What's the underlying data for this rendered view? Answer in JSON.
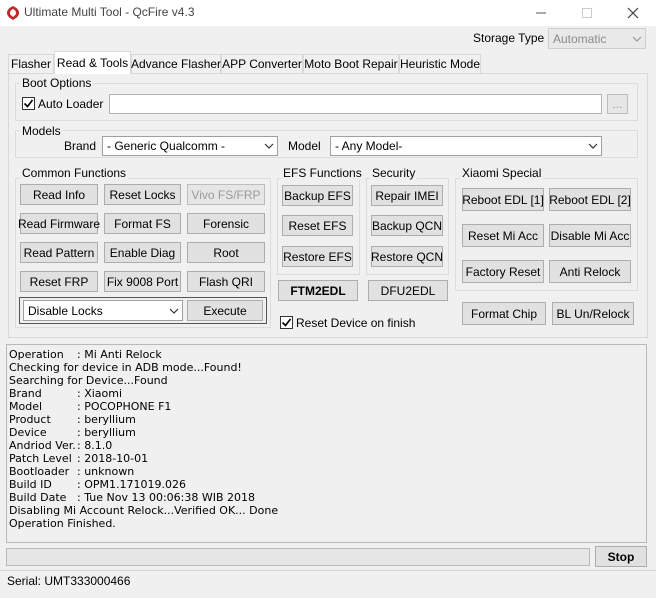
{
  "window": {
    "title": "Ultimate Multi Tool - QcFire v4.3",
    "icon": "snapdragon-icon"
  },
  "storage": {
    "label": "Storage Type",
    "value": "Automatic"
  },
  "tabs": [
    {
      "label": "Flasher"
    },
    {
      "label": "Read & Tools"
    },
    {
      "label": "Advance Flasher"
    },
    {
      "label": "APP Converter"
    },
    {
      "label": "Moto Boot Repair"
    },
    {
      "label": "Heuristic Mode"
    }
  ],
  "boot_options": {
    "title": "Boot Options",
    "auto_loader_label": "Auto Loader",
    "auto_loader_checked": true,
    "path_value": "",
    "browse_label": "..."
  },
  "models": {
    "title": "Models",
    "brand_label": "Brand",
    "brand_value": "- Generic Qualcomm -",
    "model_label": "Model",
    "model_value": "- Any Model-"
  },
  "common": {
    "title": "Common Functions",
    "read_info": "Read Info",
    "reset_locks": "Reset Locks",
    "vivo_fs_frp": "Vivo FS/FRP",
    "read_firmware": "Read Firmware",
    "format_fs": "Format FS",
    "forensic": "Forensic",
    "read_pattern": "Read Pattern",
    "enable_diag": "Enable Diag",
    "root": "Root",
    "reset_frp": "Reset FRP",
    "fix_9008": "Fix 9008 Port",
    "flash_qri": "Flash QRI",
    "locks_value": "Disable Locks",
    "execute": "Execute"
  },
  "efs": {
    "title": "EFS Functions",
    "backup": "Backup EFS",
    "reset": "Reset EFS",
    "restore": "Restore EFS"
  },
  "security": {
    "title": "Security",
    "repair_imei": "Repair IMEI",
    "backup_qcn": "Backup QCN",
    "restore_qcn": "Restore QCN"
  },
  "modes": {
    "ftm2edl": "FTM2EDL",
    "dfu2edl": "DFU2EDL",
    "reset_after_label": "Reset Device on finish",
    "reset_after_checked": true
  },
  "xiaomi": {
    "title": "Xiaomi Special",
    "reboot_edl_1": "Reboot EDL [1]",
    "reboot_edl_2": "Reboot EDL [2]",
    "reset_mi_acc": "Reset Mi Acc",
    "disable_mi_acc": "Disable Mi Acc",
    "factory_reset": "Factory Reset",
    "anti_relock": "Anti Relock"
  },
  "extra": {
    "format_chip": "Format Chip",
    "bl_unrelock": "BL Un/Relock"
  },
  "log": [
    {
      "k": "Operation",
      "v": ": Mi Anti Relock"
    },
    {
      "k": "",
      "v": "Checking for device in ADB mode...Found!"
    },
    {
      "k": "",
      "v": "Searching for Device...Found"
    },
    {
      "k": "Brand",
      "v": ": Xiaomi"
    },
    {
      "k": "Model",
      "v": ": POCOPHONE F1"
    },
    {
      "k": "Product",
      "v": ": beryllium"
    },
    {
      "k": "Device",
      "v": ": beryllium"
    },
    {
      "k": "Andriod Ver.",
      "v": ": 8.1.0"
    },
    {
      "k": "Patch Level",
      "v": ": 2018-10-01"
    },
    {
      "k": "Bootloader",
      "v": ": unknown"
    },
    {
      "k": "Build ID",
      "v": ": OPM1.171019.026"
    },
    {
      "k": "Build Date",
      "v": ": Tue Nov 13 00:06:38 WIB 2018"
    },
    {
      "k": "",
      "v": "Disabling Mi Account Relock...Verified OK... Done"
    },
    {
      "k": "",
      "v": "Operation Finished."
    }
  ],
  "progress": 0,
  "stop_label": "Stop",
  "status": {
    "serial": "Serial: UMT333000466"
  }
}
